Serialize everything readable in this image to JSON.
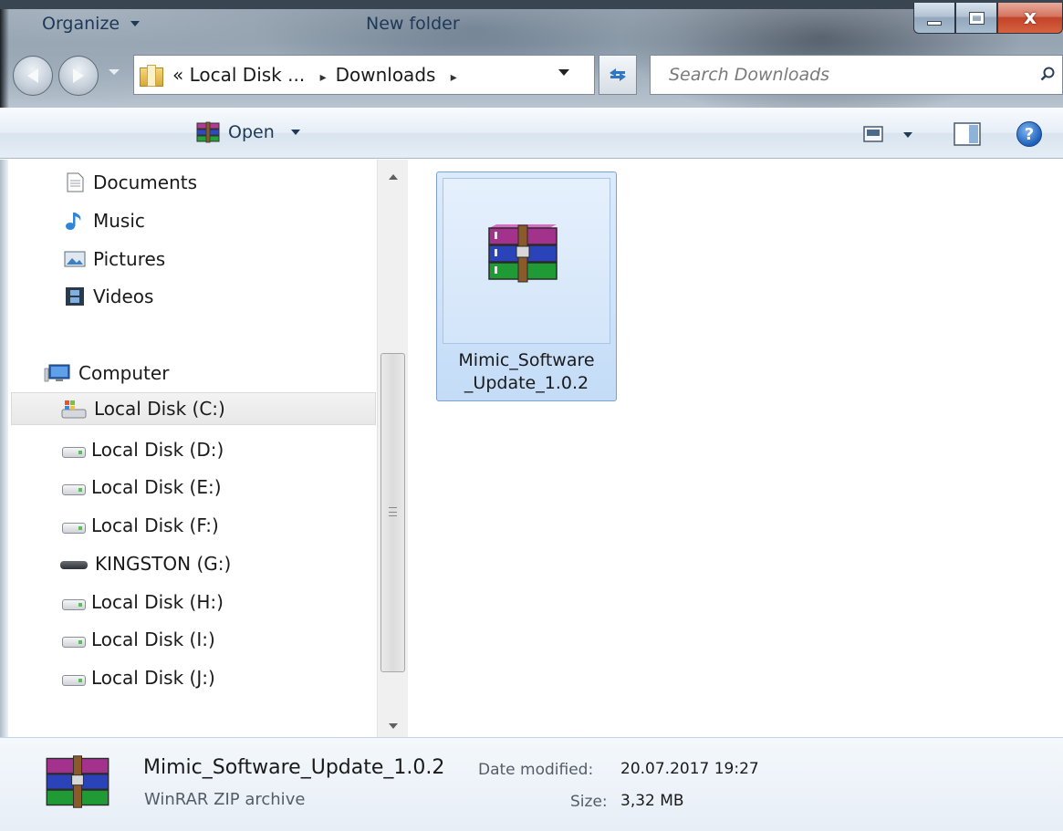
{
  "window": {
    "minimize_icon": "minimize-icon",
    "maximize_icon": "maximize-icon",
    "close_label": "x"
  },
  "address": {
    "overflow": "«",
    "crumbs": [
      "Local Disk ...",
      "Downloads"
    ],
    "separator": "▸"
  },
  "search": {
    "placeholder": "Search Downloads"
  },
  "toolbar": {
    "organize_label": "Organize",
    "open_label": "Open",
    "new_folder_label": "New folder",
    "help_label": "?"
  },
  "sidebar": {
    "libraries": [
      {
        "label": "Documents",
        "icon": "documents-icon"
      },
      {
        "label": "Music",
        "icon": "music-icon"
      },
      {
        "label": "Pictures",
        "icon": "pictures-icon"
      },
      {
        "label": "Videos",
        "icon": "videos-icon"
      }
    ],
    "computer_label": "Computer",
    "drives": [
      {
        "label": "Local Disk (C:)",
        "icon": "system-drive-icon",
        "selected": true
      },
      {
        "label": "Local Disk (D:)",
        "icon": "drive-icon"
      },
      {
        "label": "Local Disk (E:)",
        "icon": "drive-icon"
      },
      {
        "label": "Local Disk (F:)",
        "icon": "drive-icon"
      },
      {
        "label": "KINGSTON (G:)",
        "icon": "usb-drive-icon"
      },
      {
        "label": "Local Disk (H:)",
        "icon": "drive-icon"
      },
      {
        "label": "Local Disk (I:)",
        "icon": "drive-icon"
      },
      {
        "label": "Local Disk (J:)",
        "icon": "drive-icon"
      }
    ]
  },
  "files": [
    {
      "name_line1": "Mimic_Software",
      "name_line2": "_Update_1.0.2",
      "icon": "winrar-archive-icon",
      "selected": true
    }
  ],
  "details": {
    "name": "Mimic_Software_Update_1.0.2",
    "type": "WinRAR ZIP archive",
    "date_label": "Date modified:",
    "date_value": "20.07.2017 19:27",
    "size_label": "Size:",
    "size_value": "3,32 MB"
  },
  "colors": {
    "selection": "#cce0f8",
    "selection_border": "#7da2ce",
    "toolbar_text": "#1e3957"
  }
}
